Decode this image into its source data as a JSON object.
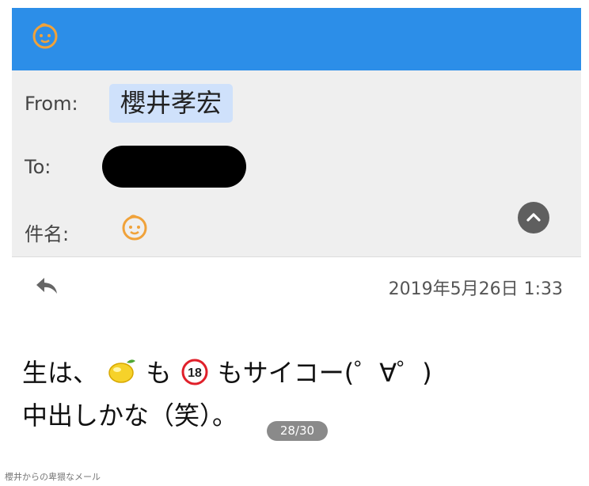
{
  "header": {
    "from_label": "From:",
    "from_value": "櫻井孝宏",
    "to_label": "To:",
    "subject_label": "件名:"
  },
  "message": {
    "date": "2019年5月26日 1:33",
    "line1_a": "生は、",
    "line1_b": "も",
    "line1_c": "もサイコー(゜∀゜)",
    "badge_number": "18",
    "line2": "中出しかな（笑）。"
  },
  "pager": {
    "label": "28/30"
  },
  "caption": "櫻井からの卑猥なメール",
  "colors": {
    "topbar": "#2c8ee8",
    "panel": "#efefef",
    "from_chip": "#cfe1fb",
    "badge_red": "#e0202a",
    "face_orange": "#f0a23a"
  },
  "icons": [
    "baby-face-icon",
    "chevron-up-icon",
    "reply-icon",
    "lemon-icon",
    "no-under-18-icon"
  ]
}
